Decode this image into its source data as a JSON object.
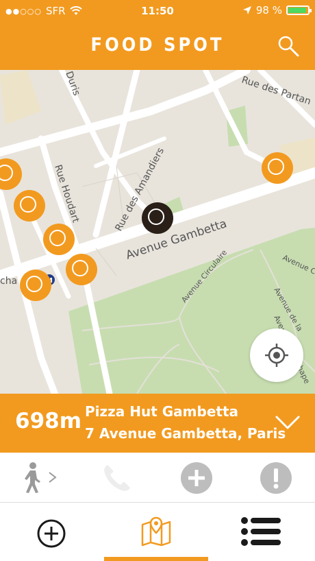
{
  "status_bar": {
    "signal_dots": "●●○○○",
    "carrier": "SFR",
    "time": "11:50",
    "battery_percent": "98 %",
    "battery_level": 0.98
  },
  "header": {
    "title": "FOOD SPOT",
    "search_icon": "search-icon"
  },
  "map": {
    "streets": {
      "duris": "Duris",
      "rue_des_partants": "Rue des Partan",
      "rue_houdart": "Rue Houdart",
      "rue_des_amandiers": "Rue des Amandiers",
      "avenue_gambetta": "Avenue Gambetta",
      "avenue_circulaire": "Avenue Circulaire",
      "avenue_right": "Avenue C",
      "avenue_de_la": "Avenue de la",
      "avenue_chapelle": "Avenue de la chape",
      "metro_label": "cha"
    },
    "metro_icon": "metro-icon",
    "locate_icon": "locate-icon"
  },
  "info_bar": {
    "distance": "698m",
    "name": "Pizza Hut Gambetta",
    "address": "7 Avenue Gambetta, Paris"
  },
  "actions": {
    "walk_icon": "walking-person-icon",
    "phone_icon": "phone-icon",
    "add_icon": "plus-icon",
    "report_icon": "exclamation-icon"
  },
  "tabs": [
    {
      "icon": "add-circle-icon"
    },
    {
      "icon": "map-icon",
      "selected": true
    },
    {
      "icon": "list-icon"
    }
  ],
  "colors": {
    "accent": "#F29A1F",
    "map_bg": "#E8E4DC",
    "park": "#C7DDB0",
    "road": "#FFFFFF",
    "pin_selected": "#2A2018"
  }
}
